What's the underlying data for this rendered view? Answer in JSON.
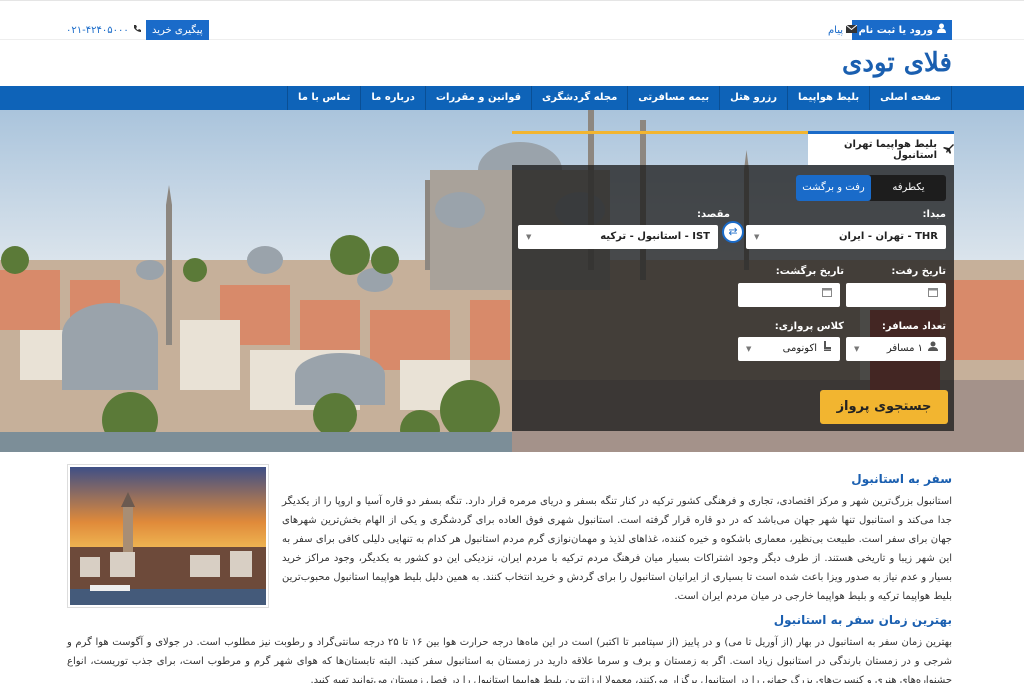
{
  "topbar": {
    "login_label": "ورود یا ثبت نام",
    "message_label": "پیام",
    "track_label": "پیگیری خرید",
    "phone": "۰۲۱-۴۲۴۰۵۰۰۰"
  },
  "header": {
    "logo_text": "فلای تودی"
  },
  "nav": {
    "items": [
      "صفحه اصلی",
      "بلیط هواپیما",
      "رزرو هتل",
      "بیمه مسافرتی",
      "مجله گردشگری",
      "قوانین و مقررات",
      "درباره ما",
      "تماس با ما"
    ]
  },
  "search": {
    "tab_label": "بلیط هواپیما تهران استانبول",
    "one_way": "یکطرفه",
    "round_trip": "رفت و برگشت",
    "origin_label": "مبدا:",
    "origin_value": "THR - تهران - ایران",
    "destination_label": "مقصد:",
    "destination_value": "IST - استانبول - ترکیه",
    "depart_label": "تاریخ رفت:",
    "return_label": "تاریخ برگشت:",
    "passengers_label": "تعداد مسافر:",
    "passengers_value": "۱ مسافر",
    "class_label": "کلاس پروازی:",
    "class_value": "اکونومی",
    "search_button": "جستجوی پرواز"
  },
  "article": {
    "title": "سفر به استانبول",
    "paragraph1": "استانبول بزرگ‌ترین شهر و مرکز اقتصادی، تجاری و فرهنگی کشور ترکیه در کنار تنگه بسفر و دریای مرمره قرار دارد. تنگه بسفر دو قاره آسیا و اروپا را از یکدیگر جدا می‌کند و استانبول تنها شهر جهان می‌باشد که در دو قاره قرار گرفته است. استانبول شهری فوق العاده برای گردشگری و یکی از الهام بخش‌ترین شهرهای جهان برای سفر است. طبیعت بی‌نظیر، معماری باشکوه و خیره کننده، غذاهای لذیذ و مهمان‌نوازی گرم مردم استانبول هر کدام به تنهایی دلیلی کافی برای سفر به این شهر زیبا و تاریخی هستند. از طرف دیگر وجود اشتراکات بسیار میان فرهنگ مردم ترکیه با مردم ایران، نزدیکی این دو کشور به یکدیگر، وجود مراکز خرید بسیار و عدم نیاز به صدور ویزا باعث شده است تا بسیاری از ایرانیان استانبول را برای گردش و خرید انتخاب کنند. به همین دلیل بلیط هواپیما استانبول محبوب‌ترین بلیط هواپیما ترکیه و بلیط هواپیما خارجی در میان مردم ایران است.",
    "subtitle": "بهترین زمان سفر به استانبول",
    "paragraph2": "بهترین زمان سفر به استانبول در بهار (از آوریل تا می) و در پاییز (از سپتامبر تا اکتبر) است در این ماه‌ها درجه حرارت هوا بین ۱۶ تا ۲۵ درجه سانتی‌گراد و رطوبت نیز مطلوب است. در جولای و آگوست هوا گرم و شرجی و در زمستان بارندگی در استانبول زیاد است. اگر به زمستان و برف و سرما علاقه دارید در زمستان به استانبول سفر کنید. البته تابستان‌ها که هوای شهر گرم و مرطوب است، برای جذب توریست، انواع جشنواره‌های هنری و کنسرت‌های بزرگ جهانی را در استانبول برگزار می‌کنند، معمولا ارزانترین بلیط هواپیما استانبول را در فصل زمستان می‌توانید تهیه کنید."
  },
  "colors": {
    "primary": "#0e63b8",
    "accent": "#f2b530"
  }
}
